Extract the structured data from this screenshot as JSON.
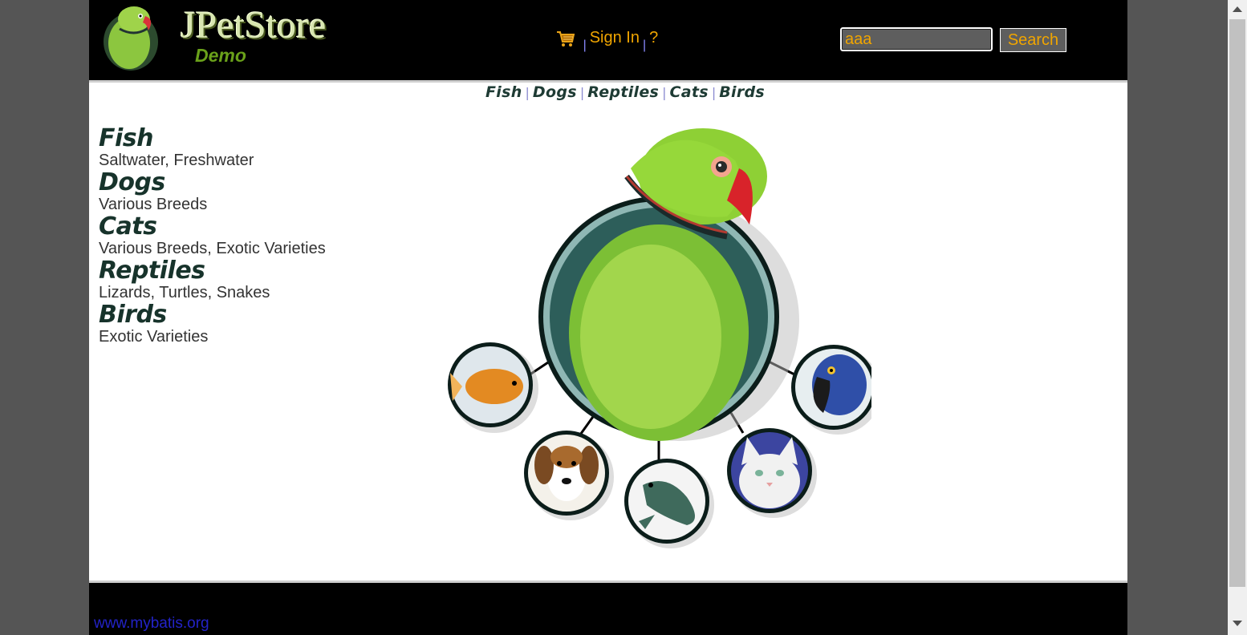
{
  "header": {
    "logo_title": "JPetStore",
    "logo_subtitle": "Demo",
    "menu": {
      "cart_icon": "shopping-cart-icon",
      "sign_in": "Sign In",
      "help": "?"
    },
    "search": {
      "value": "aaa",
      "button_label": "Search"
    }
  },
  "quicklinks": [
    "Fish",
    "Dogs",
    "Reptiles",
    "Cats",
    "Birds"
  ],
  "sidebar": {
    "categories": [
      {
        "title": "Fish",
        "desc": "Saltwater, Freshwater"
      },
      {
        "title": "Dogs",
        "desc": "Various Breeds"
      },
      {
        "title": "Cats",
        "desc": "Various Breeds, Exotic Varieties"
      },
      {
        "title": "Reptiles",
        "desc": "Lizards, Turtles, Snakes"
      },
      {
        "title": "Birds",
        "desc": "Exotic Varieties"
      }
    ]
  },
  "footer": {
    "link": "www.mybatis.org"
  },
  "colors": {
    "header_bg": "#000000",
    "menu_text": "#f0a500",
    "footer_link": "#2323c8",
    "category_title": "#17332b"
  }
}
